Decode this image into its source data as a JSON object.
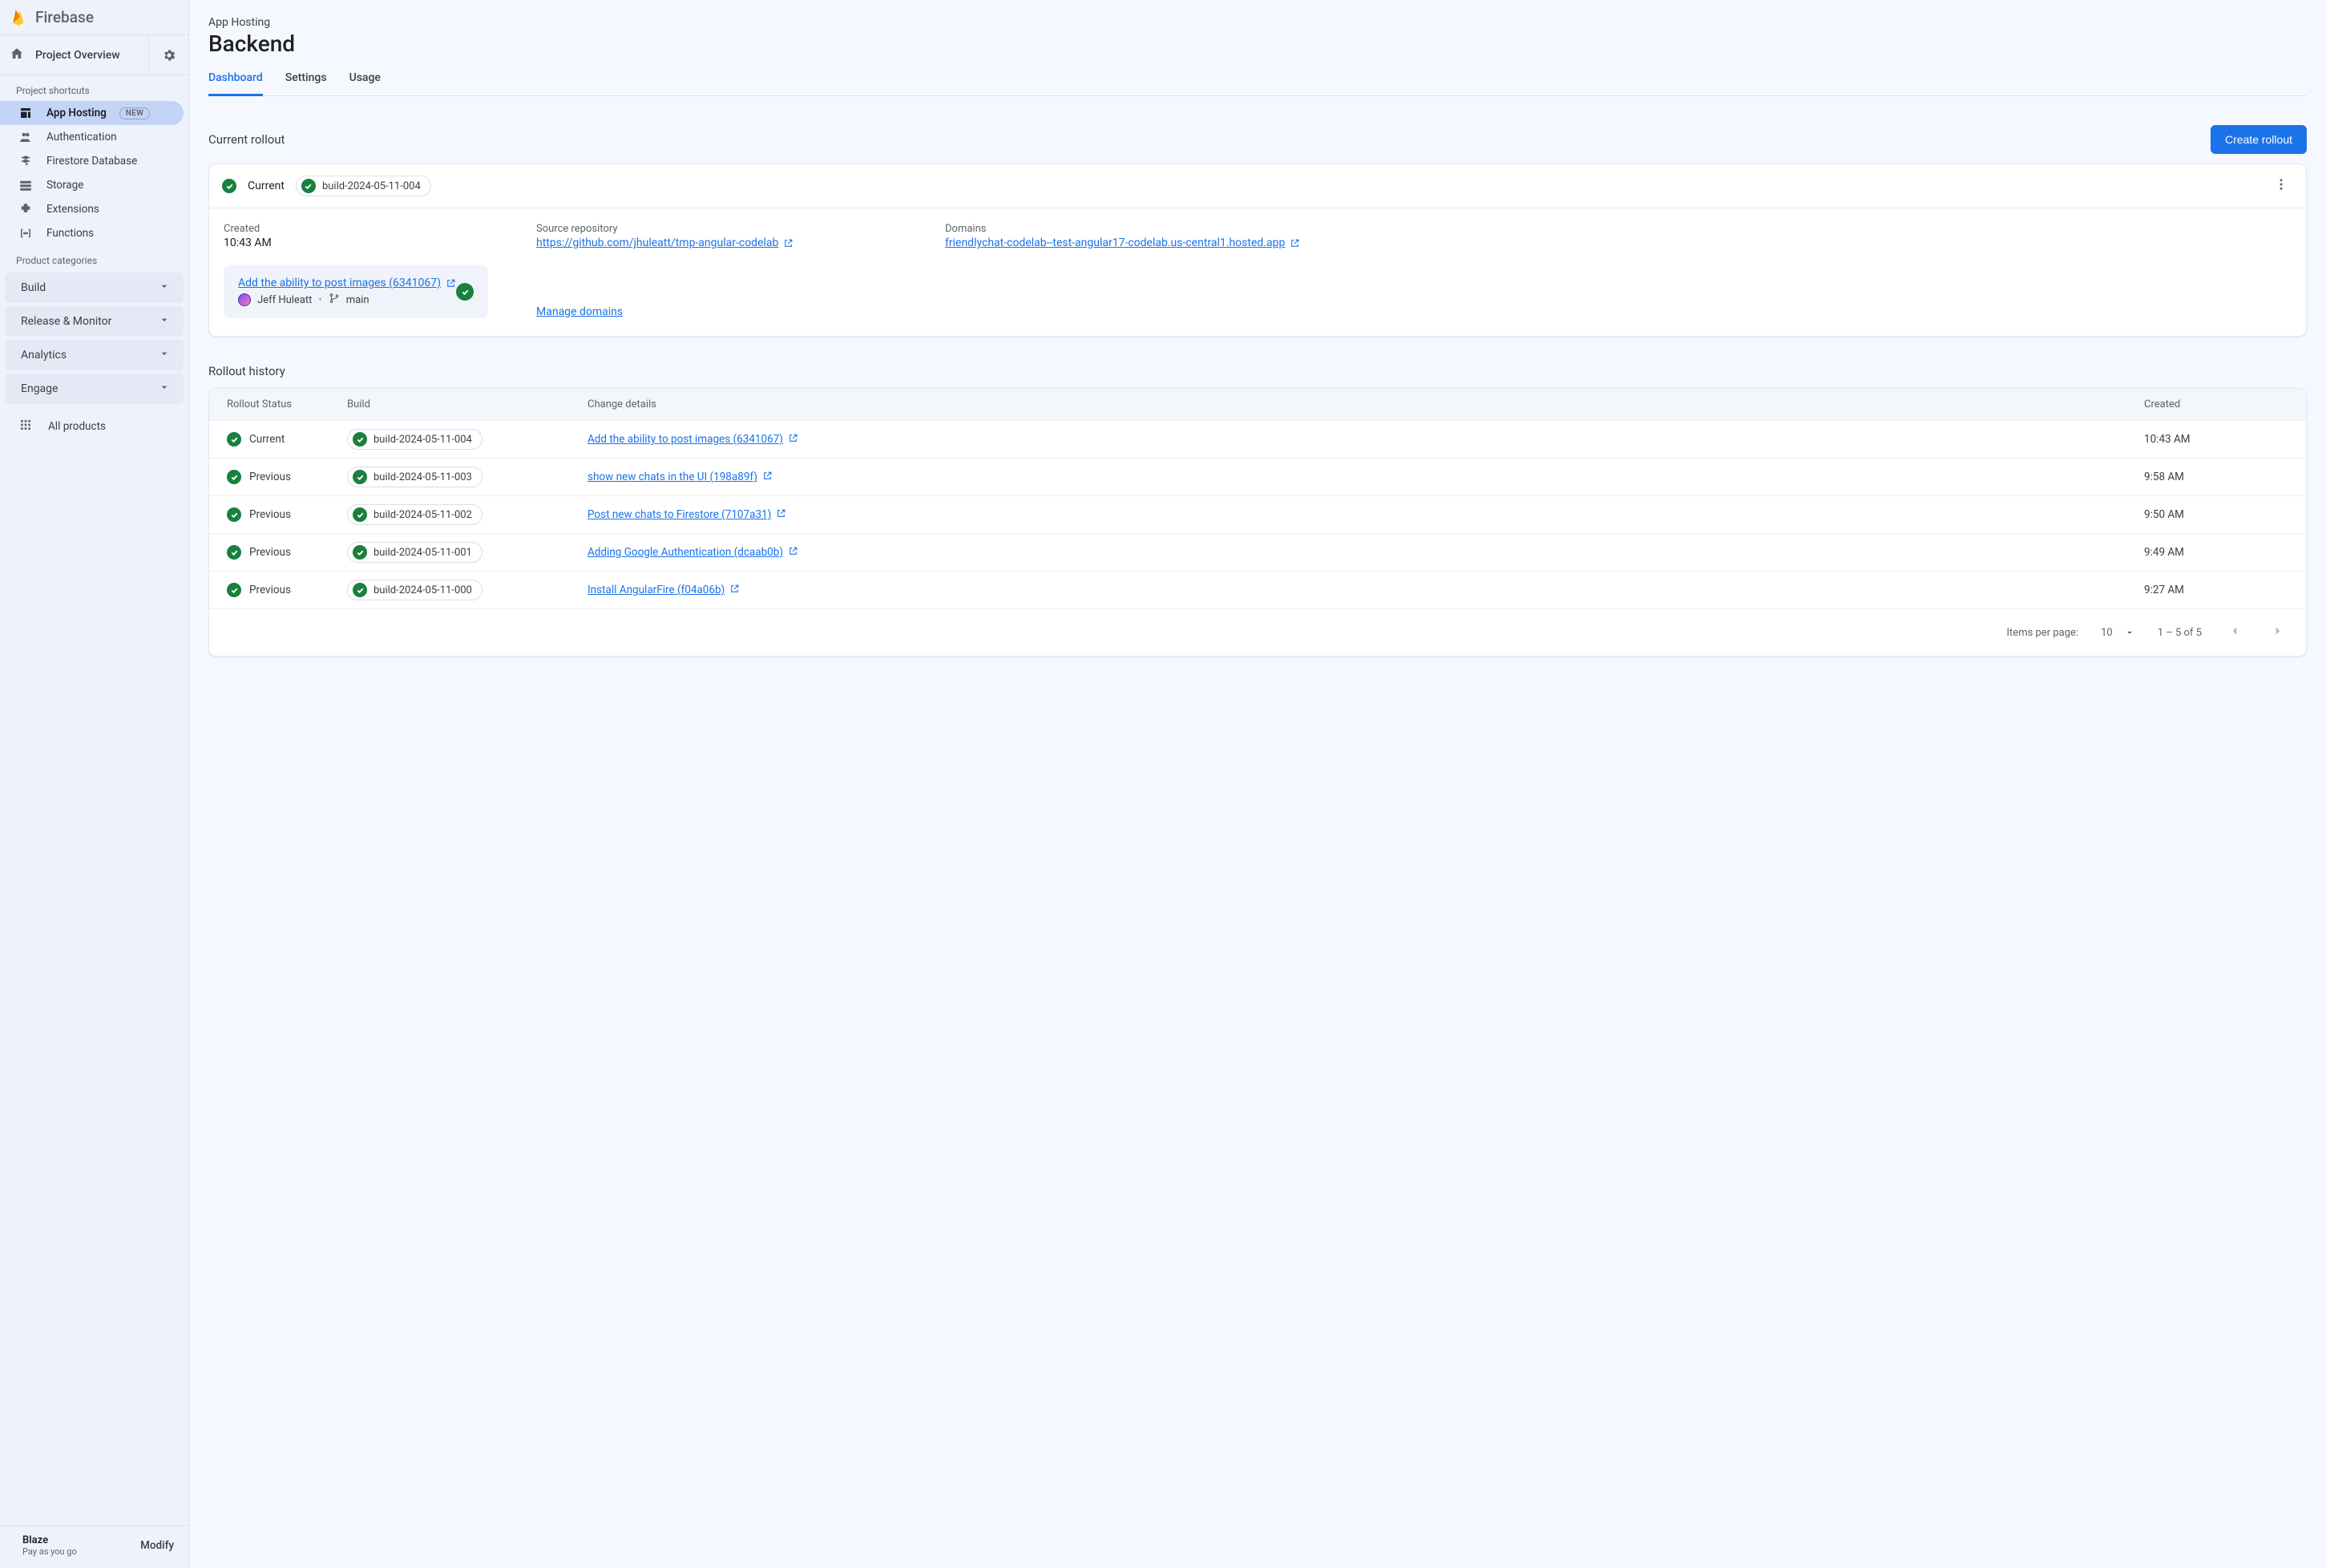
{
  "brand": "Firebase",
  "project_overview_label": "Project Overview",
  "sidebar": {
    "shortcuts_header": "Project shortcuts",
    "items": [
      {
        "label": "App Hosting",
        "badge": "NEW",
        "active": true
      },
      {
        "label": "Authentication"
      },
      {
        "label": "Firestore Database"
      },
      {
        "label": "Storage"
      },
      {
        "label": "Extensions"
      },
      {
        "label": "Functions"
      }
    ],
    "categories_header": "Product categories",
    "categories": [
      {
        "label": "Build"
      },
      {
        "label": "Release & Monitor"
      },
      {
        "label": "Analytics"
      },
      {
        "label": "Engage"
      }
    ],
    "all_products": "All products",
    "plan": {
      "name": "Blaze",
      "sub": "Pay as you go",
      "modify": "Modify"
    }
  },
  "breadcrumb": "App Hosting",
  "page_title": "Backend",
  "tabs": [
    {
      "label": "Dashboard",
      "active": true
    },
    {
      "label": "Settings"
    },
    {
      "label": "Usage"
    }
  ],
  "current_rollout": {
    "section_label": "Current rollout",
    "button": "Create rollout",
    "status_label": "Current",
    "build_chip": "build-2024-05-11-004",
    "created_label": "Created",
    "created_value": "10:43 AM",
    "repo_label": "Source repository",
    "repo_url": "https://github.com/jhuleatt/tmp-angular-codelab",
    "domains_label": "Domains",
    "domain": "friendlychat-codelab--test-angular17-codelab.us-central1.hosted.app",
    "commit_msg": "Add the ability to post images (6341067)",
    "author": "Jeff Huleatt",
    "branch": "main",
    "manage_domains": "Manage domains"
  },
  "history": {
    "section_label": "Rollout history",
    "columns": {
      "status": "Rollout Status",
      "build": "Build",
      "change": "Change details",
      "created": "Created"
    },
    "rows": [
      {
        "status": "Current",
        "build": "build-2024-05-11-004",
        "change": "Add the ability to post images (6341067)",
        "created": "10:43 AM"
      },
      {
        "status": "Previous",
        "build": "build-2024-05-11-003",
        "change": "show new chats in the UI (198a89f)",
        "created": "9:58 AM"
      },
      {
        "status": "Previous",
        "build": "build-2024-05-11-002",
        "change": "Post new chats to Firestore (7107a31)",
        "created": "9:50 AM"
      },
      {
        "status": "Previous",
        "build": "build-2024-05-11-001",
        "change": "Adding Google Authentication (dcaab0b)",
        "created": "9:49 AM"
      },
      {
        "status": "Previous",
        "build": "build-2024-05-11-000",
        "change": "Install AngularFire (f04a06b)",
        "created": "9:27 AM"
      }
    ],
    "footer": {
      "items_per_page_label": "Items per page:",
      "items_per_page_value": "10",
      "range": "1 – 5 of 5"
    }
  }
}
